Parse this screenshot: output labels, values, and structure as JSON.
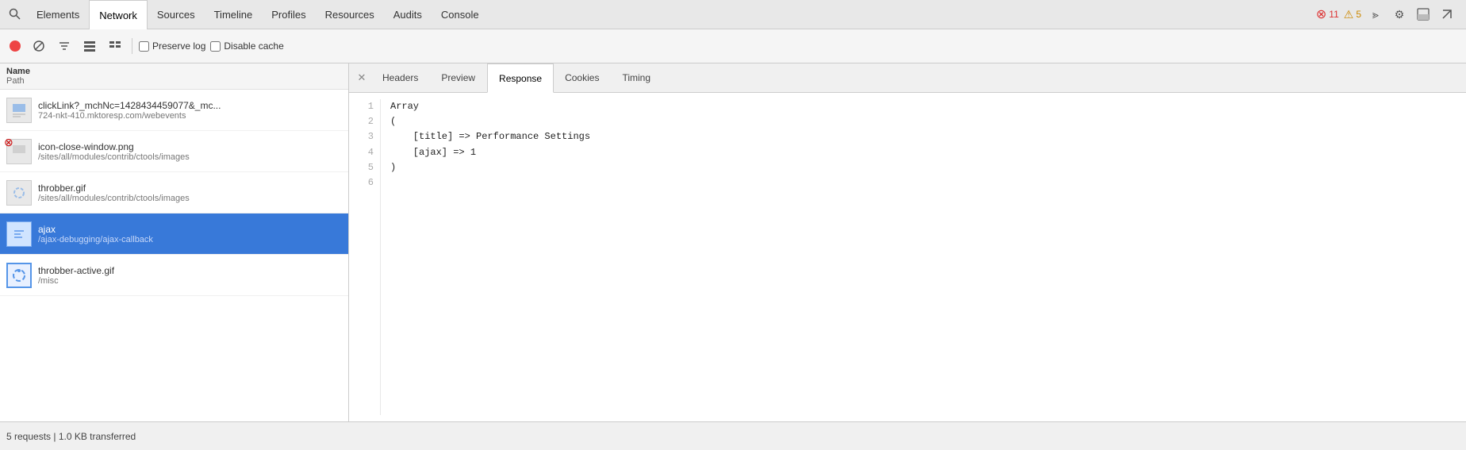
{
  "topNav": {
    "items": [
      {
        "label": "Elements",
        "active": false
      },
      {
        "label": "Network",
        "active": true
      },
      {
        "label": "Sources",
        "active": false
      },
      {
        "label": "Timeline",
        "active": false
      },
      {
        "label": "Profiles",
        "active": false
      },
      {
        "label": "Resources",
        "active": false
      },
      {
        "label": "Audits",
        "active": false
      },
      {
        "label": "Console",
        "active": false
      }
    ],
    "errorCount": "11",
    "warningCount": "5"
  },
  "toolbar": {
    "preserveLogLabel": "Preserve log",
    "disableCacheLabel": "Disable cache"
  },
  "leftPanel": {
    "headerName": "Name",
    "headerPath": "Path",
    "files": [
      {
        "id": "file1",
        "name": "clickLink?_mchNc=1428434459077&_mc...",
        "path": "724-nkt-410.mktoresp.com/webevents",
        "iconType": "image",
        "selected": false
      },
      {
        "id": "file2",
        "name": "icon-close-window.png",
        "path": "/sites/all/modules/contrib/ctools/images",
        "iconType": "image-x",
        "selected": false
      },
      {
        "id": "file3",
        "name": "throbber.gif",
        "path": "/sites/all/modules/contrib/ctools/images",
        "iconType": "spinner",
        "selected": false
      },
      {
        "id": "file4",
        "name": "ajax",
        "path": "/ajax-debugging/ajax-callback",
        "iconType": "ajax",
        "selected": true
      },
      {
        "id": "file5",
        "name": "throbber-active.gif",
        "path": "/misc",
        "iconType": "spinner-blue",
        "selected": false
      }
    ]
  },
  "rightPanel": {
    "tabs": [
      {
        "label": "Headers",
        "active": false
      },
      {
        "label": "Preview",
        "active": false
      },
      {
        "label": "Response",
        "active": true
      },
      {
        "label": "Cookies",
        "active": false
      },
      {
        "label": "Timing",
        "active": false
      }
    ],
    "response": {
      "lines": [
        {
          "num": "1",
          "code": "Array"
        },
        {
          "num": "2",
          "code": "("
        },
        {
          "num": "3",
          "code": "    [title] => Performance Settings"
        },
        {
          "num": "4",
          "code": "    [ajax] => 1"
        },
        {
          "num": "5",
          "code": ")"
        },
        {
          "num": "6",
          "code": ""
        }
      ]
    }
  },
  "statusBar": {
    "text": "5 requests | 1.0 KB transferred"
  }
}
